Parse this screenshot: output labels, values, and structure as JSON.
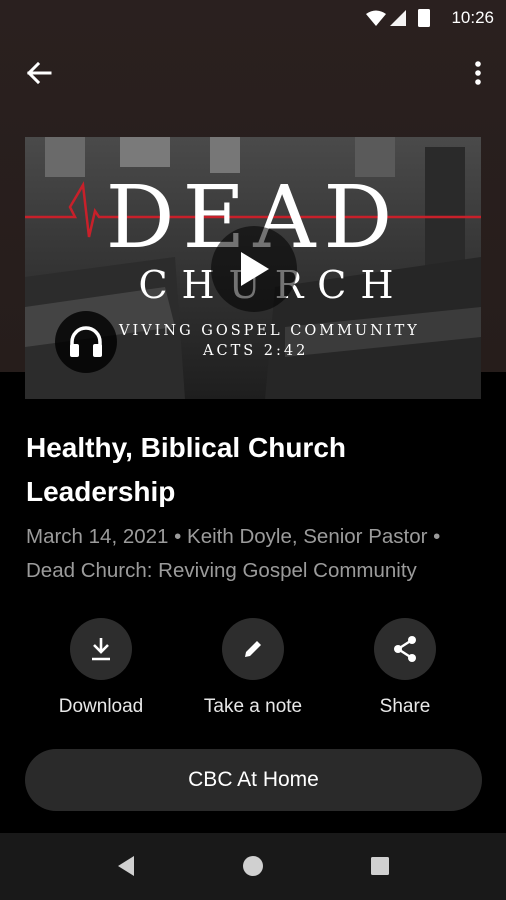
{
  "status_bar": {
    "time": "10:26",
    "icons": [
      "wifi-icon",
      "signal-icon",
      "battery-icon"
    ]
  },
  "app_bar": {
    "back_icon": "arrow-back-icon",
    "more_icon": "more-vert-icon"
  },
  "artwork": {
    "title_big": "DEAD",
    "title_sub": "CHURCH",
    "line1": "VIVING GOSPEL COMMUNITY",
    "line2": "ACTS 2:42",
    "accent_line_color": "#c8202a",
    "play_icon": "play-icon",
    "audio_icon": "headphones-icon"
  },
  "sermon": {
    "title": "Healthy, Biblical Church Leadership",
    "meta": "March 14, 2021 • Keith Doyle, Senior Pastor • Dead Church: Reviving Gospel Community"
  },
  "actions": [
    {
      "label": "Download",
      "icon": "download-icon"
    },
    {
      "label": "Take a note",
      "icon": "pencil-icon"
    },
    {
      "label": "Share",
      "icon": "share-icon"
    }
  ],
  "home_button": {
    "label": "CBC At Home"
  },
  "nav_bar": {
    "icons": [
      "back-triangle-icon",
      "home-circle-icon",
      "recents-square-icon"
    ]
  },
  "colors": {
    "header_bg": "#2a201f",
    "body_bg": "#000000",
    "meta_text": "#9b9b9b",
    "button_bg": "#2d2d2d"
  }
}
